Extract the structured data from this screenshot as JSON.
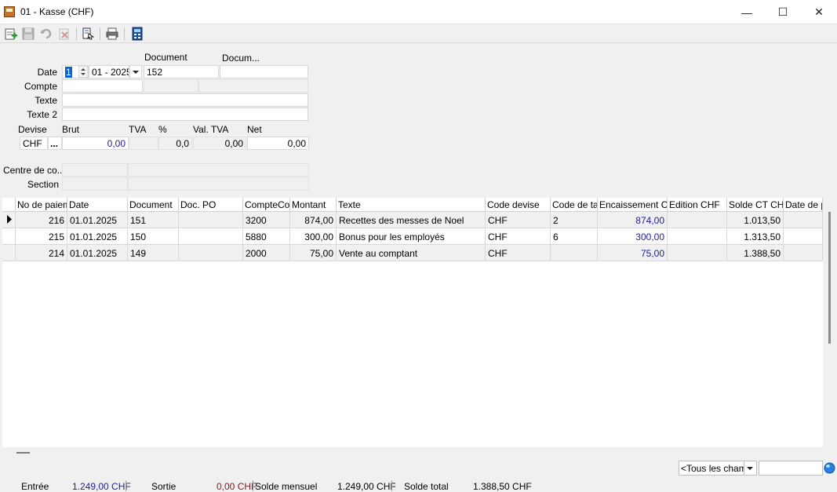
{
  "window": {
    "title": "01 - Kasse (CHF)",
    "minimize": "—",
    "maximize": "☐",
    "close": "✕"
  },
  "toolbar": {
    "buttons": [
      "new-icon",
      "save-icon",
      "undo-icon",
      "delete-icon",
      "import-icon",
      "print-icon",
      "calculator-icon"
    ]
  },
  "form": {
    "date_label": "Date",
    "date_day": "1",
    "date_rest": "01 - 2025",
    "document_label": "Document",
    "document_value": "152",
    "docum_label": "Docum...",
    "docum_value": "",
    "compte_label": "Compte",
    "texte_label": "Texte",
    "texte2_label": "Texte 2",
    "devise_label": "Devise",
    "devise_value": "CHF",
    "devise_btn": "...",
    "brut_label": "Brut",
    "brut_value": "0,00",
    "tva_label": "TVA",
    "pct_label": "%",
    "pct_value": "0,0",
    "valtva_label": "Val. TVA",
    "valtva_value": "0,00",
    "net_label": "Net",
    "net_value": "0,00",
    "centre_label": "Centre de co...",
    "section_label": "Section"
  },
  "table": {
    "headers": [
      "No de paiement",
      "Date",
      "Document",
      "Doc. PO",
      "CompteCom",
      "Montant",
      "Texte",
      "Code devise",
      "Code de taxe",
      "Encaissement CHF",
      "Edition CHF",
      "Solde CT CHF",
      "Date de pr"
    ],
    "rows": [
      {
        "no": "216",
        "date": "01.01.2025",
        "document": "151",
        "docpo": "",
        "compte": "3200",
        "montant": "874,00",
        "texte": "Recettes des messes de Noel",
        "devise": "CHF",
        "taxe": "2",
        "encaissement": "874,00",
        "edition": "",
        "solde": "1.013,50",
        "datepr": ""
      },
      {
        "no": "215",
        "date": "01.01.2025",
        "document": "150",
        "docpo": "",
        "compte": "5880",
        "montant": "300,00",
        "texte": "Bonus pour les employés",
        "devise": "CHF",
        "taxe": "6",
        "encaissement": "300,00",
        "edition": "",
        "solde": "1.313,50",
        "datepr": ""
      },
      {
        "no": "214",
        "date": "01.01.2025",
        "document": "149",
        "docpo": "",
        "compte": "2000",
        "montant": "75,00",
        "texte": "Vente au comptant",
        "devise": "CHF",
        "taxe": "",
        "encaissement": "75,00",
        "edition": "",
        "solde": "1.388,50",
        "datepr": ""
      }
    ]
  },
  "filter": {
    "field_value": "<Tous les champs>",
    "search_value": ""
  },
  "status": {
    "entree_label": "Entrée",
    "entree_value": "1.249,00 CHF",
    "sortie_label": "Sortie",
    "sortie_value": "0,00 CHF",
    "mensuel_label": "Solde mensuel",
    "mensuel_value": "1.249,00 CHF",
    "total_label": "Solde total",
    "total_value": "1.388,50 CHF"
  }
}
